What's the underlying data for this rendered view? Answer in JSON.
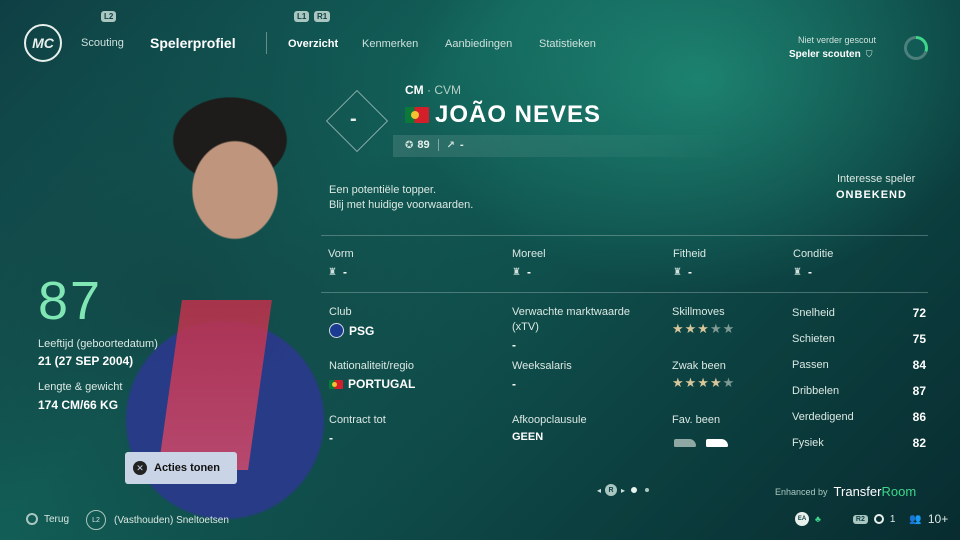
{
  "topbar": {
    "logo": "MC",
    "lb_badge": "L2",
    "scouting": "Scouting",
    "title": "Spelerprofiel",
    "l1_badge": "L1",
    "r1_badge": "R1",
    "tabs": [
      "Overzicht",
      "Kenmerken",
      "Aanbiedingen",
      "Statistieken"
    ],
    "scout_status": "Niet verder gescout",
    "scout_button": "Speler scouten",
    "scout_progress": 0.3
  },
  "player": {
    "position_main": "CM",
    "position_alt": "· CVM",
    "name": "JOÃO NEVES",
    "diamond_value": "-",
    "rating": "89",
    "potential": "-",
    "ovr": "87",
    "age_label": "Leeftijd (geboortedatum)",
    "age_value": "21 (27 SEP 2004)",
    "hw_label": "Lengte & gewicht",
    "hw_value": "174 CM/66 KG",
    "comment_line1": "Een potentiële topper.",
    "comment_line2": "Blij met huidige voorwaarden.",
    "interest_label": "Interesse speler",
    "interest_value": "ONBEKEND"
  },
  "status": {
    "vorm_label": "Vorm",
    "vorm_value": "-",
    "moreel_label": "Moreel",
    "moreel_value": "-",
    "fitheid_label": "Fitheid",
    "fitheid_value": "-",
    "conditie_label": "Conditie",
    "conditie_value": "-"
  },
  "info": {
    "club_label": "Club",
    "club_value": "PSG",
    "market_label": "Verwachte marktwaarde",
    "market_label2": "(xTV)",
    "market_value": "-",
    "nation_label": "Nationaliteit/regio",
    "nation_value": "PORTUGAL",
    "wage_label": "Weeksalaris",
    "wage_value": "-",
    "contract_label": "Contract tot",
    "contract_value": "-",
    "release_label": "Afkoopclausule",
    "release_value": "GEEN",
    "skill_label": "Skillmoves",
    "skill_stars": 3,
    "weakfoot_label": "Zwak been",
    "weakfoot_stars": 4,
    "foot_label": "Fav. been"
  },
  "attributes": [
    {
      "label": "Snelheid",
      "value": "72"
    },
    {
      "label": "Schieten",
      "value": "75"
    },
    {
      "label": "Passen",
      "value": "84"
    },
    {
      "label": "Dribbelen",
      "value": "87"
    },
    {
      "label": "Verdedigend",
      "value": "86"
    },
    {
      "label": "Fysiek",
      "value": "82"
    }
  ],
  "actions_button": "Acties tonen",
  "pager": {
    "r_badge": "R",
    "left": "◂",
    "right": "▸"
  },
  "enhanced_by": "Enhanced by",
  "brand_a": "Transfer",
  "brand_b": "Room",
  "bottom": {
    "back": "Terug",
    "l2": "L2",
    "shortcuts": "(Vasthouden) Sneltoetsen",
    "ea": "EA",
    "r2": "R2",
    "count1": "1",
    "count2": "10+"
  },
  "colors": {
    "accent": "#7fe6b4",
    "bg": "#126058",
    "star": "#d7c79a"
  },
  "icons": [
    "cross-icon",
    "circle-icon",
    "shirt-icon",
    "star-icon",
    "boot-icon",
    "user-group-icon"
  ]
}
